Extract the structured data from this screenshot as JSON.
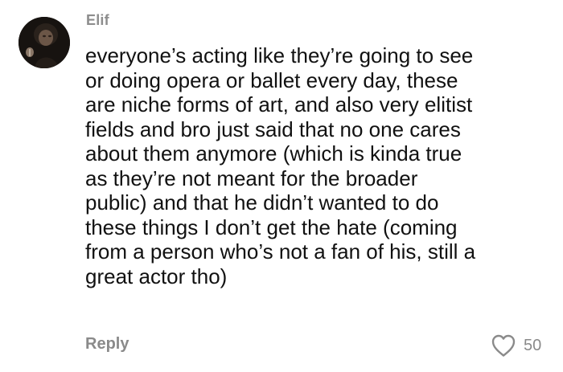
{
  "comment": {
    "username": "Elif",
    "text": "everyone’s acting like they’re going to see\nor doing opera or ballet every day, these\nare niche forms of art, and also very elitist\nfields and bro just said that no one cares\nabout them anymore (which is kinda true\nas they’re not meant for the broader\npublic) and that he didn’t wanted to do\nthese things I don’t get the hate (coming\nfrom a person who’s not a fan of his, still a\ngreat actor tho)",
    "reply_label": "Reply",
    "like_count": "50",
    "avatar_icon": "user-avatar",
    "like_icon": "heart-outline-icon"
  },
  "colors": {
    "username": "#8d8d8d",
    "text": "#111111",
    "meta": "#8a8a8a",
    "background": "#ffffff"
  }
}
